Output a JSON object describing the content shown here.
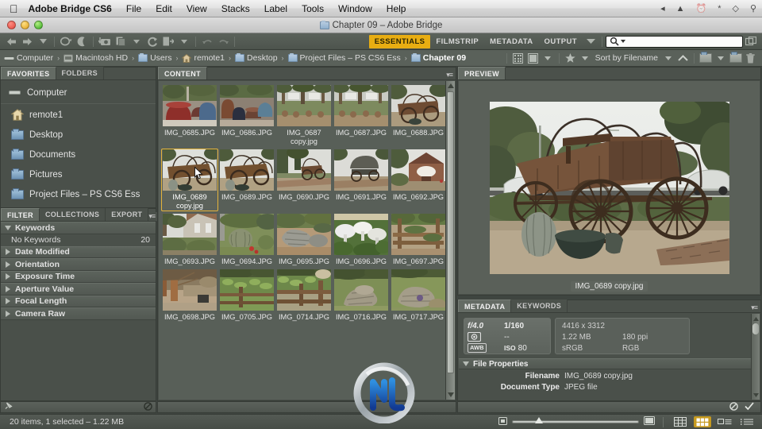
{
  "mac_menu": {
    "apple_icon": "apple-icon",
    "app_name": "Adobe Bridge CS6",
    "items": [
      "File",
      "Edit",
      "View",
      "Stacks",
      "Label",
      "Tools",
      "Window",
      "Help"
    ],
    "status_icons": [
      "volume-icon",
      "eject-icon",
      "timemachine-icon",
      "bluetooth-icon",
      "wifi-icon",
      "spotlight-icon"
    ]
  },
  "window": {
    "title": "Chapter 09 – Adobe Bridge",
    "folder_icon": "folder-icon",
    "close_button": "close-button",
    "minimize_button": "minimize-button",
    "zoom_button": "zoom-button"
  },
  "toolbar": {
    "back_icon": "back-arrow-icon",
    "forward_icon": "forward-arrow-icon",
    "recent_icon": "chevron-down-icon",
    "boomerang_icon": "revert-icon",
    "boomerang_arrow": "chevron-down-icon",
    "bridge_icon": "moon-icon",
    "photodownloader_icon": "camera-download-icon",
    "refine_icon": "copies-icon",
    "refine_arrow": "chevron-down-icon",
    "rotate_icon": "refresh-icon",
    "open_icon": "open-in-icon",
    "open_arrow": "chevron-down-icon",
    "undo_icon": "rotate-ccw-icon",
    "redo_icon": "rotate-cw-icon",
    "workspaces": [
      {
        "label": "ESSENTIALS",
        "active": true
      },
      {
        "label": "FILMSTRIP",
        "active": false
      },
      {
        "label": "METADATA",
        "active": false
      },
      {
        "label": "OUTPUT",
        "active": false
      }
    ],
    "workspace_more_icon": "chevron-down-icon",
    "search_icon": "search-icon",
    "search_value": "",
    "search_placeholder": "",
    "compact_mode_icon": "compact-window-icon"
  },
  "pathbar": {
    "crumbs": [
      {
        "label": "Computer",
        "icon": "computer-icon",
        "current": false
      },
      {
        "label": "Macintosh HD",
        "icon": "harddisk-icon",
        "current": false
      },
      {
        "label": "Users",
        "icon": "users-folder-icon",
        "current": false
      },
      {
        "label": "remote1",
        "icon": "home-icon",
        "current": false
      },
      {
        "label": "Desktop",
        "icon": "desktop-folder-icon",
        "current": false
      },
      {
        "label": "Project Files – PS CS6 Ess",
        "icon": "folder-icon",
        "current": false
      },
      {
        "label": "Chapter 09",
        "icon": "folder-icon",
        "current": true
      }
    ],
    "separator": "›",
    "tools": {
      "filter_rating_icon": "filter-grid-icon",
      "filter_items_icon": "filter-items-icon",
      "filter_items_arrow": "chevron-down-icon",
      "star_icon": "star-icon",
      "star_arrow": "chevron-down-icon",
      "sort_label": "Sort by Filename",
      "sort_arrow": "chevron-down-icon",
      "sort_direction_icon": "chevron-up-icon",
      "new_folder_icon": "open-folder-icon",
      "new_folder_arrow": "chevron-down-icon",
      "create_folder_icon": "new-folder-icon",
      "delete_icon": "trash-icon"
    }
  },
  "favorites_panel": {
    "tabs": [
      {
        "label": "FAVORITES",
        "active": true
      },
      {
        "label": "FOLDERS",
        "active": false
      }
    ],
    "items": [
      {
        "label": "Computer",
        "icon": "computer-icon"
      },
      {
        "label": "remote1",
        "icon": "home-icon"
      },
      {
        "label": "Desktop",
        "icon": "desktop-folder-icon"
      },
      {
        "label": "Documents",
        "icon": "documents-folder-icon"
      },
      {
        "label": "Pictures",
        "icon": "pictures-folder-icon"
      },
      {
        "label": "Project Files – PS CS6 Ess",
        "icon": "folder-icon"
      }
    ]
  },
  "filter_panel": {
    "tabs": [
      {
        "label": "FILTER",
        "active": true
      },
      {
        "label": "COLLECTIONS",
        "active": false
      },
      {
        "label": "EXPORT",
        "active": false
      }
    ],
    "flyout_icon": "panel-menu-icon",
    "groups": [
      {
        "label": "Keywords",
        "expanded": true,
        "values": [
          {
            "label": "No Keywords",
            "count": "20"
          }
        ]
      },
      {
        "label": "Date Modified",
        "expanded": false,
        "values": []
      },
      {
        "label": "Orientation",
        "expanded": false,
        "values": []
      },
      {
        "label": "Exposure Time",
        "expanded": false,
        "values": []
      },
      {
        "label": "Aperture Value",
        "expanded": false,
        "values": []
      },
      {
        "label": "Focal Length",
        "expanded": false,
        "values": []
      },
      {
        "label": "Camera Raw",
        "expanded": false,
        "values": []
      }
    ]
  },
  "content_panel": {
    "tab": "CONTENT",
    "flyout_icon": "panel-menu-icon",
    "scrollbar": "content-scrollbar",
    "rows": [
      [
        {
          "name": "IMG_0685.JPG",
          "selected": false,
          "thumb": "pots-red"
        },
        {
          "name": "IMG_0686.JPG",
          "selected": false,
          "thumb": "pots-blue"
        },
        {
          "name": "IMG_0687 copy.jpg",
          "selected": false,
          "thumb": "nursery"
        },
        {
          "name": "IMG_0687.JPG",
          "selected": false,
          "thumb": "nursery"
        },
        {
          "name": "IMG_0688.JPG",
          "selected": false,
          "thumb": "wagon-a"
        }
      ],
      [
        {
          "name": "IMG_0689 copy.jpg",
          "selected": true,
          "thumb": "wagon-b"
        },
        {
          "name": "IMG_0689.JPG",
          "selected": false,
          "thumb": "wagon-b"
        },
        {
          "name": "IMG_0690.JPG",
          "selected": false,
          "thumb": "wagon-c"
        },
        {
          "name": "IMG_0691.JPG",
          "selected": false,
          "thumb": "wagon-d"
        },
        {
          "name": "IMG_0692.JPG",
          "selected": false,
          "thumb": "barn"
        }
      ],
      [
        {
          "name": "IMG_0693.JPG",
          "selected": false,
          "thumb": "house"
        },
        {
          "name": "IMG_0694.JPG",
          "selected": false,
          "thumb": "cactus"
        },
        {
          "name": "IMG_0695.JPG",
          "selected": false,
          "thumb": "rocks"
        },
        {
          "name": "IMG_0696.JPG",
          "selected": false,
          "thumb": "mushroom"
        },
        {
          "name": "IMG_0697.JPG",
          "selected": false,
          "thumb": "bench"
        }
      ],
      [
        {
          "name": "IMG_0698.JPG",
          "selected": false,
          "thumb": "pavilion"
        },
        {
          "name": "IMG_0705.JPG",
          "selected": false,
          "thumb": "pond-a"
        },
        {
          "name": "IMG_0714.JPG",
          "selected": false,
          "thumb": "pond-b"
        },
        {
          "name": "IMG_0716.JPG",
          "selected": false,
          "thumb": "falls-a"
        },
        {
          "name": "IMG_0717.JPG",
          "selected": false,
          "thumb": "falls-b"
        }
      ]
    ]
  },
  "preview_panel": {
    "tab": "PREVIEW",
    "image_label": "IMG_0689 copy.jpg",
    "image_alt": "antique wooden covered wagon"
  },
  "metadata_panel": {
    "tabs": [
      {
        "label": "METADATA",
        "active": true
      },
      {
        "label": "KEYWORDS",
        "active": false
      }
    ],
    "flyout_icon": "panel-menu-icon",
    "camera": {
      "aperture": "f/4.0",
      "shutter": "1/160",
      "metering_icon": "metering-mode-icon",
      "exposure_compensation": "--",
      "white_balance": "AWB",
      "iso_label": "ISO",
      "iso_value": "80"
    },
    "file": {
      "dimensions": "4416 x 3312",
      "size": "1.22 MB",
      "resolution": "180 ppi",
      "color_profile": "sRGB",
      "color_mode": "RGB"
    },
    "sections": [
      {
        "label": "File Properties",
        "expanded": true,
        "rows": [
          {
            "key": "Filename",
            "value": "IMG_0689 copy.jpg"
          },
          {
            "key": "Document Type",
            "value": "JPEG file"
          }
        ]
      }
    ],
    "cancel_icon": "cancel-icon",
    "apply_icon": "apply-check-icon"
  },
  "keyword_bar": {
    "pin_icon": "pin-icon",
    "no_drop_icon": "no-drop-icon"
  },
  "status_bar": {
    "text": "20 items, 1 selected – 1.22 MB",
    "thumbnail_small_icon": "small-thumbnail-icon",
    "thumbnail_large_icon": "large-thumbnail-icon",
    "zoom_slider_value": 18,
    "view_buttons": [
      {
        "icon": "grid-lock-icon",
        "active": false
      },
      {
        "icon": "thumbnail-view-icon",
        "active": true
      },
      {
        "icon": "details-view-icon",
        "active": false
      },
      {
        "icon": "list-view-icon",
        "active": false
      }
    ]
  },
  "colors": {
    "accent": "#e8ad12",
    "selection": "#e4b33c",
    "panel_bg": "#4a504a",
    "content_bg": "#585f58",
    "chrome": "#5a615a"
  }
}
